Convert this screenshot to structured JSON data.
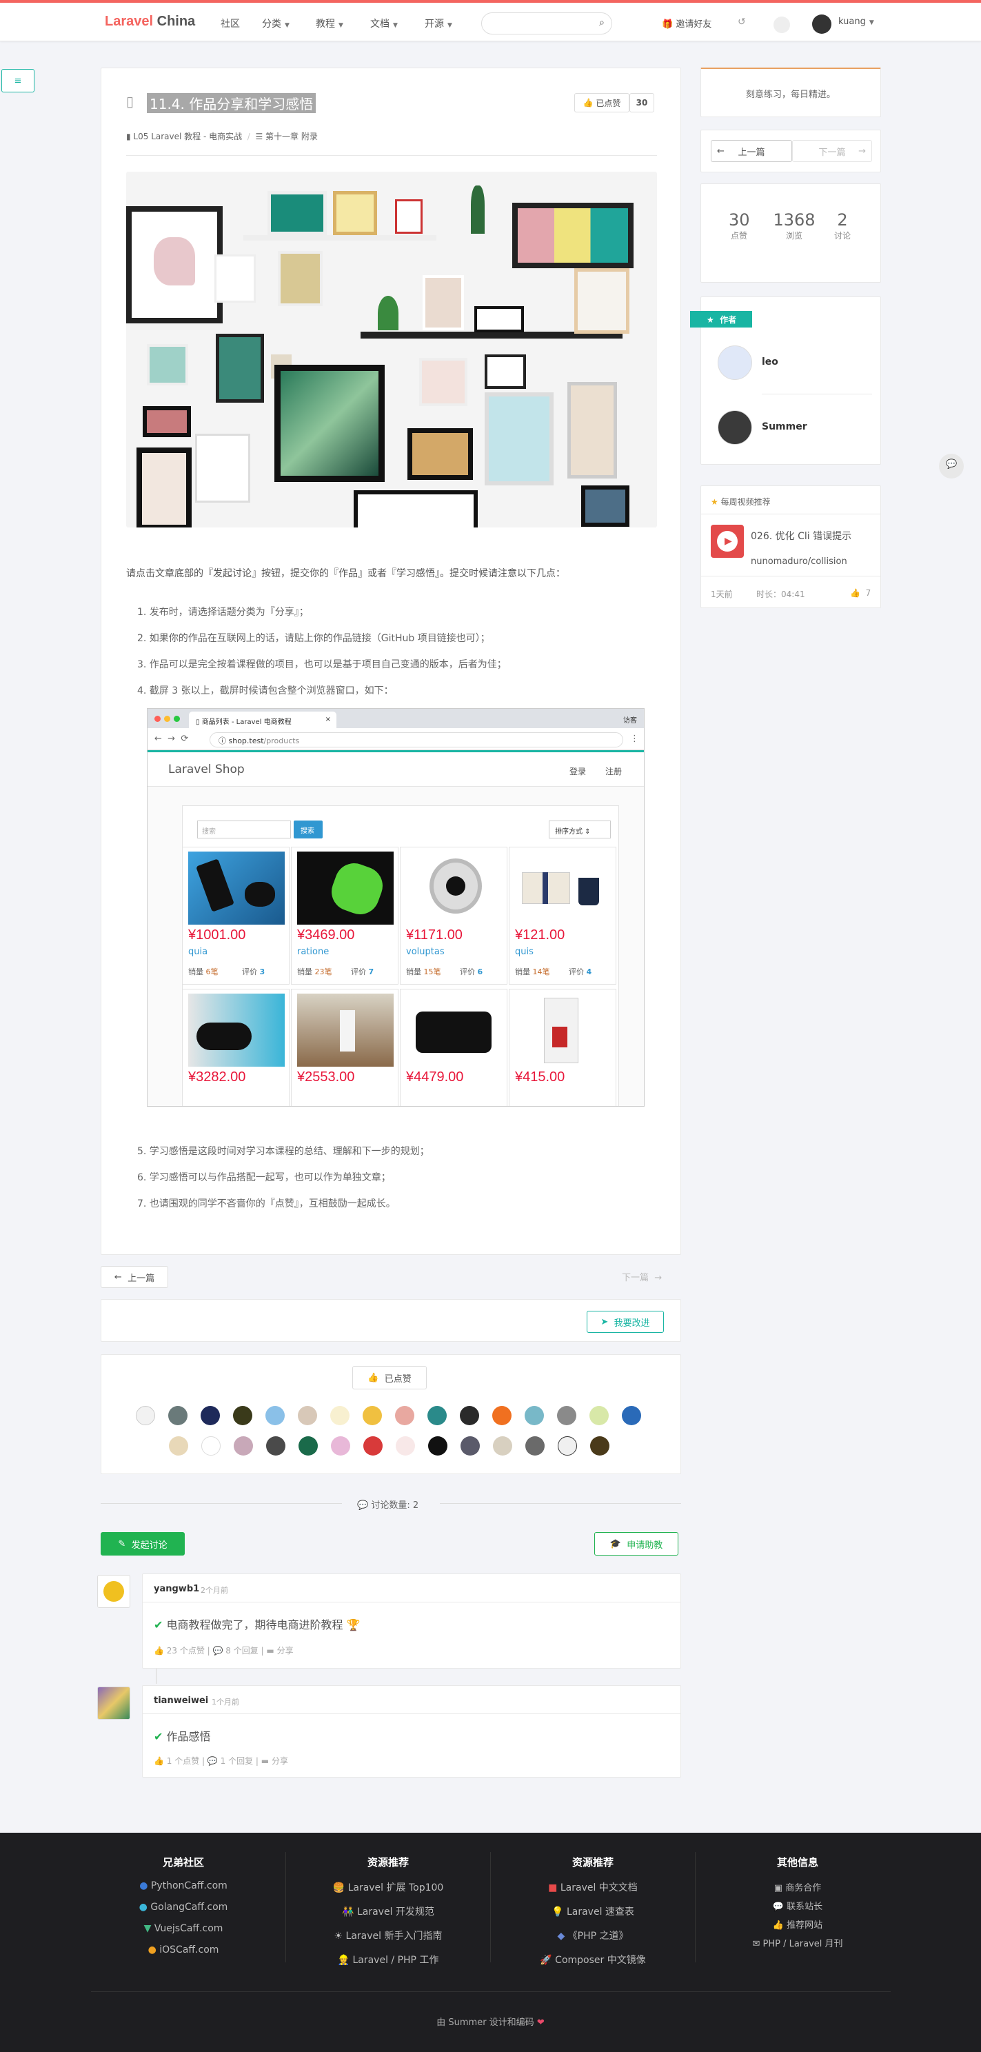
{
  "nav": {
    "brand_a": "Laravel",
    "brand_b": "China",
    "items": [
      "社区",
      "分类",
      "教程",
      "文档",
      "开源"
    ],
    "invite": "邀请好友",
    "user": "kuang"
  },
  "article": {
    "title": "11.4. 作品分享和学习感悟",
    "vote_label": "已点赞",
    "vote_count": "30",
    "crumb_book": "L05 Laravel 教程 - 电商实战",
    "crumb_chapter": "第十一章 附录",
    "intro": "请点击文章底部的『发起讨论』按钮，提交你的『作品』或者『学习感悟』。提交时候请注意以下几点：",
    "list": [
      "1. 发布时，请选择话题分类为『分享』；",
      "2. 如果你的作品在互联网上的话，请贴上你的作品链接（GitHub 项目链接也可）；",
      "3. 作品可以是完全按着课程做的项目，也可以是基于项目自己变通的版本，后者为佳；",
      "4. 截屏 3 张以上，截屏时候请包含整个浏览器窗口，如下："
    ],
    "list2": [
      "5. 学习感悟是这段时间对学习本课程的总结、理解和下一步的规划；",
      "6. 学习感悟可以与作品搭配一起写，也可以作为单独文章；",
      "7. 也请围观的同学不吝啬你的『点赞』，互相鼓励一起成长。"
    ]
  },
  "browser": {
    "tab_title": "商品列表 - Laravel 电商教程",
    "guest": "访客",
    "url_host": "shop.test",
    "url_path": "/products",
    "site_name": "Laravel Shop",
    "login": "登录",
    "register": "注册",
    "search_placeholder": "搜索",
    "search_btn": "搜索",
    "sort": "排序方式",
    "products": [
      {
        "price": "¥1001.00",
        "name": "quia",
        "sales": "销量",
        "sales_n": "6笔",
        "rev": "评价",
        "rev_n": "3"
      },
      {
        "price": "¥3469.00",
        "name": "ratione",
        "sales": "销量",
        "sales_n": "23笔",
        "rev": "评价",
        "rev_n": "7"
      },
      {
        "price": "¥1171.00",
        "name": "voluptas",
        "sales": "销量",
        "sales_n": "15笔",
        "rev": "评价",
        "rev_n": "6"
      },
      {
        "price": "¥121.00",
        "name": "quis",
        "sales": "销量",
        "sales_n": "14笔",
        "rev": "评价",
        "rev_n": "4"
      },
      {
        "price": "¥3282.00"
      },
      {
        "price": "¥2553.00"
      },
      {
        "price": "¥4479.00"
      },
      {
        "price": "¥415.00"
      }
    ]
  },
  "pager": {
    "prev": "上一篇",
    "next": "下一篇"
  },
  "improve": "我要改进",
  "likes_label": "已点赞",
  "discuss_count": "讨论数量: 2",
  "start_discuss": "发起讨论",
  "help": "申请助教",
  "replies": [
    {
      "user": "yangwb1",
      "time": "2个月前",
      "title": "电商教程做完了，期待电商进阶教程",
      "meta1": "23 个点赞",
      "meta2": "8 个回复",
      "meta3": "分享"
    },
    {
      "user": "tianweiwei",
      "time": "1个月前",
      "title": "作品感悟",
      "meta1": "1 个点赞",
      "meta2": "1 个回复",
      "meta3": "分享"
    }
  ],
  "sidebar": {
    "motto": "刻意练习，每日精进。",
    "prev": "上一篇",
    "next": "下一篇",
    "stats": [
      {
        "n": "30",
        "l": "点赞"
      },
      {
        "n": "1368",
        "l": "浏览"
      },
      {
        "n": "2",
        "l": "讨论"
      }
    ],
    "author_tag": "作者",
    "authors": [
      "leo",
      "Summer"
    ],
    "video_head": "每周视频推荐",
    "video_title": "026. 优化 Cli 错误提示",
    "video_pkg": "nunomaduro/collision",
    "video_time": "1天前",
    "video_len": "时长：04:41",
    "video_likes": "7"
  },
  "footer": {
    "cols": [
      {
        "title": "兄弟社区",
        "items": [
          "PythonCaff.com",
          "GolangCaff.com",
          "VuejsCaff.com",
          "iOSCaff.com"
        ]
      },
      {
        "title": "资源推荐",
        "items": [
          "Laravel 扩展 Top100",
          "Laravel 开发规范",
          "Laravel 新手入门指南",
          "Laravel / PHP 工作"
        ]
      },
      {
        "title": "资源推荐",
        "items": [
          "Laravel 中文文档",
          "Laravel 速查表",
          "《PHP 之道》",
          "Composer 中文镜像"
        ]
      },
      {
        "title": "其他信息",
        "items": [
          "商务合作",
          "联系站长",
          "推荐网站",
          "PHP / Laravel 月刊"
        ]
      }
    ],
    "credit": "由 Summer 设计和编码"
  }
}
